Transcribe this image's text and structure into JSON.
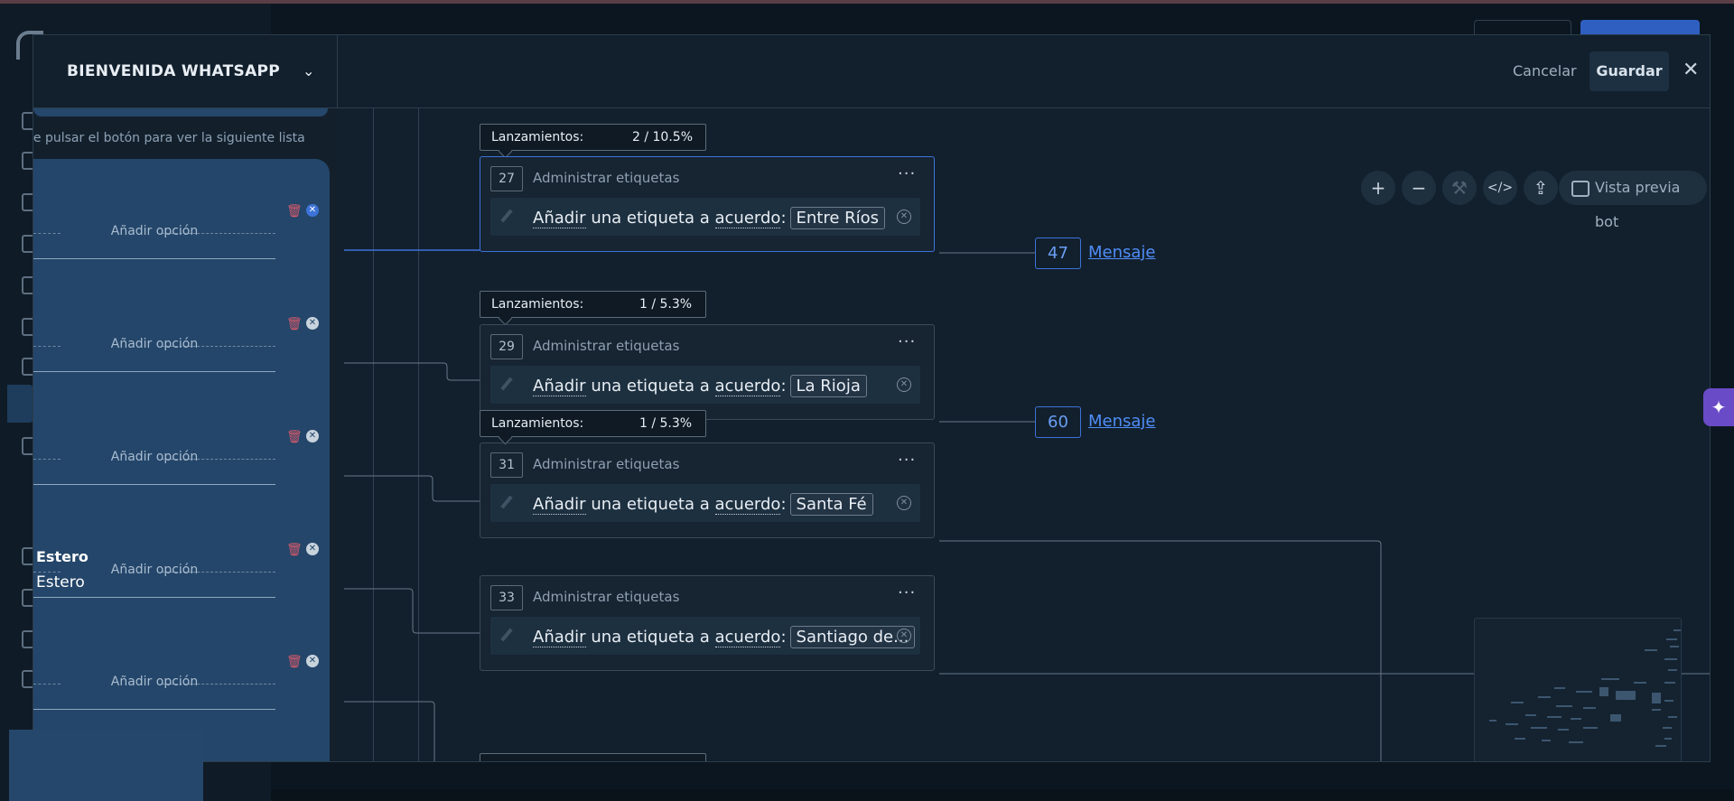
{
  "header": {
    "flow_name": "BIENVENIDA WHATSAPP",
    "cancel_label": "Cancelar",
    "save_label": "Guardar"
  },
  "left_panel": {
    "hint": "le pulsar el botón para ver la siguiente lista",
    "add_option_label": "Añadir opción",
    "option_title_bold": "Estero",
    "option_title": "Estero"
  },
  "toolbar": {
    "zoom_in": "+",
    "zoom_out": "−",
    "code": "</>",
    "preview_label": "Vista previa bot"
  },
  "nodes": [
    {
      "id": "27",
      "title": "Administrar etiquetas",
      "action_prefix_1": "Añadir",
      "action_mid_1": " una etiqueta a ",
      "action_prefix_2": "acuerdo",
      "action_sep": ":",
      "tag": "Entre Ríos",
      "launch_label": "Lanzamientos:",
      "launch_value": "2 / 10.5%",
      "target_id": "47",
      "target_label": "Mensaje"
    },
    {
      "id": "29",
      "title": "Administrar etiquetas",
      "action_prefix_1": "Añadir",
      "action_mid_1": " una etiqueta a ",
      "action_prefix_2": "acuerdo",
      "action_sep": ":",
      "tag": "La Rioja",
      "launch_label": "Lanzamientos:",
      "launch_value": "1 / 5.3%",
      "target_id": "60",
      "target_label": "Mensaje"
    },
    {
      "id": "31",
      "title": "Administrar etiquetas",
      "action_prefix_1": "Añadir",
      "action_mid_1": " una etiqueta a ",
      "action_prefix_2": "acuerdo",
      "action_sep": ":",
      "tag": "Santa Fé",
      "launch_label": "Lanzamientos:",
      "launch_value": "1 / 5.3%"
    },
    {
      "id": "33",
      "title": "Administrar etiquetas",
      "action_prefix_1": "Añadir",
      "action_mid_1": " una etiqueta a ",
      "action_prefix_2": "acuerdo",
      "action_sep": ":",
      "tag": "Santiago de..."
    }
  ],
  "icons": {
    "close": "close-icon",
    "chevron": "chevron-down-icon",
    "trash": "trash-icon",
    "remove": "remove-circle-icon",
    "more": "more-horizontal-icon",
    "ai": "sparkle-icon"
  },
  "colors": {
    "accent": "#3d73d8",
    "option_card": "#24466a",
    "delete": "#d65a6a",
    "ai_button": "#6a4bc7"
  }
}
